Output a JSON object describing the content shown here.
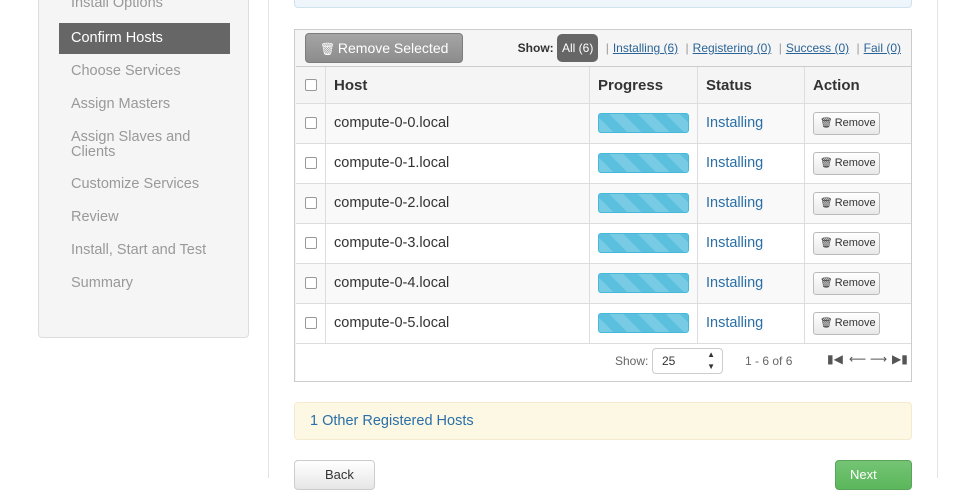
{
  "sidebar": {
    "items": [
      {
        "label": "Install Options",
        "active": false
      },
      {
        "label": "Confirm Hosts",
        "active": true
      },
      {
        "label": "Choose Services",
        "active": false
      },
      {
        "label": "Assign Masters",
        "active": false
      },
      {
        "label": "Assign Slaves and Clients",
        "active": false
      },
      {
        "label": "Customize Services",
        "active": false
      },
      {
        "label": "Review",
        "active": false
      },
      {
        "label": "Install, Start and Test",
        "active": false
      },
      {
        "label": "Summary",
        "active": false
      }
    ]
  },
  "toolbar": {
    "remove_selected_label": "Remove Selected",
    "show_label": "Show:",
    "filters": [
      {
        "label": "All (6)",
        "active": true
      },
      {
        "label": "Installing (6)",
        "active": false
      },
      {
        "label": "Registering (0)",
        "active": false
      },
      {
        "label": "Success (0)",
        "active": false
      },
      {
        "label": "Fail (0)",
        "active": false
      }
    ]
  },
  "table": {
    "columns": [
      "Host",
      "Progress",
      "Status",
      "Action"
    ],
    "rows": [
      {
        "host": "compute-0-0.local",
        "status": "Installing",
        "action": "Remove",
        "progress": 1.0
      },
      {
        "host": "compute-0-1.local",
        "status": "Installing",
        "action": "Remove",
        "progress": 1.0
      },
      {
        "host": "compute-0-2.local",
        "status": "Installing",
        "action": "Remove",
        "progress": 1.0
      },
      {
        "host": "compute-0-3.local",
        "status": "Installing",
        "action": "Remove",
        "progress": 1.0
      },
      {
        "host": "compute-0-4.local",
        "status": "Installing",
        "action": "Remove",
        "progress": 1.0
      },
      {
        "host": "compute-0-5.local",
        "status": "Installing",
        "action": "Remove",
        "progress": 1.0
      }
    ]
  },
  "pagination": {
    "show_label": "Show:",
    "page_size": "25",
    "range": "1 - 6 of 6"
  },
  "other_hosts": {
    "label": "1 Other Registered Hosts"
  },
  "buttons": {
    "back_label": "Back",
    "next_label": "Next"
  },
  "colors": {
    "active_nav_bg": "#666666",
    "progress_bar": "#5bc0de",
    "status_link": "#2a6fa8",
    "next_button": "#5bb75b",
    "alert_bg": "#fcf8e3"
  }
}
